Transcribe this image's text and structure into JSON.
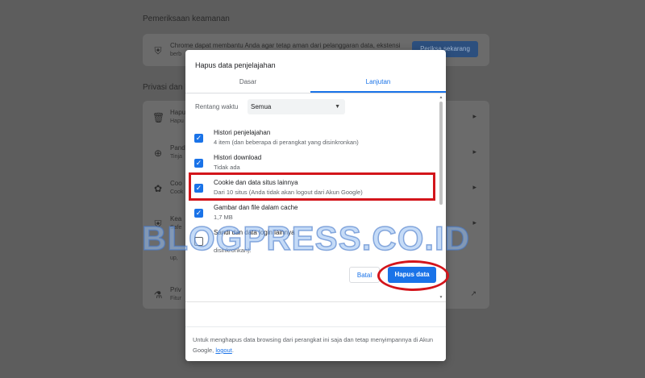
{
  "background": {
    "security_heading": "Pemeriksaan keamanan",
    "security_desc_line1": "Chrome dapat membantu Anda agar tetap aman dari pelanggaran data, ekstensi",
    "security_desc_line2": "berb",
    "security_button": "Periksa sekarang",
    "privacy_heading": "Privasi dan k",
    "rows": [
      {
        "title": "Hapu",
        "sub": "Hapu"
      },
      {
        "title": "Pand",
        "sub": "Tinja"
      },
      {
        "title": "Coo",
        "sub": "Cook"
      },
      {
        "title": "Kea",
        "sub": "Safe"
      },
      {
        "title": "",
        "sub": "up, "
      },
      {
        "title": "Priv",
        "sub": "Fitur"
      }
    ]
  },
  "dialog": {
    "title": "Hapus data penjelajahan",
    "tabs": {
      "basic": "Dasar",
      "advanced": "Lanjutan"
    },
    "time_range_label": "Rentang waktu",
    "time_range_value": "Semua",
    "options": [
      {
        "title": "Histori penjelajahan",
        "subtitle": "4 item (dan beberapa di perangkat yang disinkronkan)",
        "checked": true
      },
      {
        "title": "Histori download",
        "subtitle": "Tidak ada",
        "checked": true
      },
      {
        "title": "Cookie dan data situs lainnya",
        "subtitle": "Dari 10 situs (Anda tidak akan logout dari Akun Google)",
        "checked": true
      },
      {
        "title": "Gambar dan file dalam cache",
        "subtitle": "1,7 MB",
        "checked": true
      },
      {
        "title": "Sandi dan data login lainnya",
        "subtitle": "",
        "checked": false
      }
    ],
    "partial_option_text": "disinkronkan).",
    "cancel_button": "Batal",
    "clear_button": "Hapus data",
    "footer_text": "Untuk menghapus data browsing dari perangkat ini saja dan tetap menyimpannya di Akun Google,",
    "footer_link": "logout",
    "footer_end": "."
  },
  "watermark": "BLOGPRESS.CO.ID",
  "colors": {
    "accent": "#1a73e8",
    "highlight": "#d3151b"
  }
}
